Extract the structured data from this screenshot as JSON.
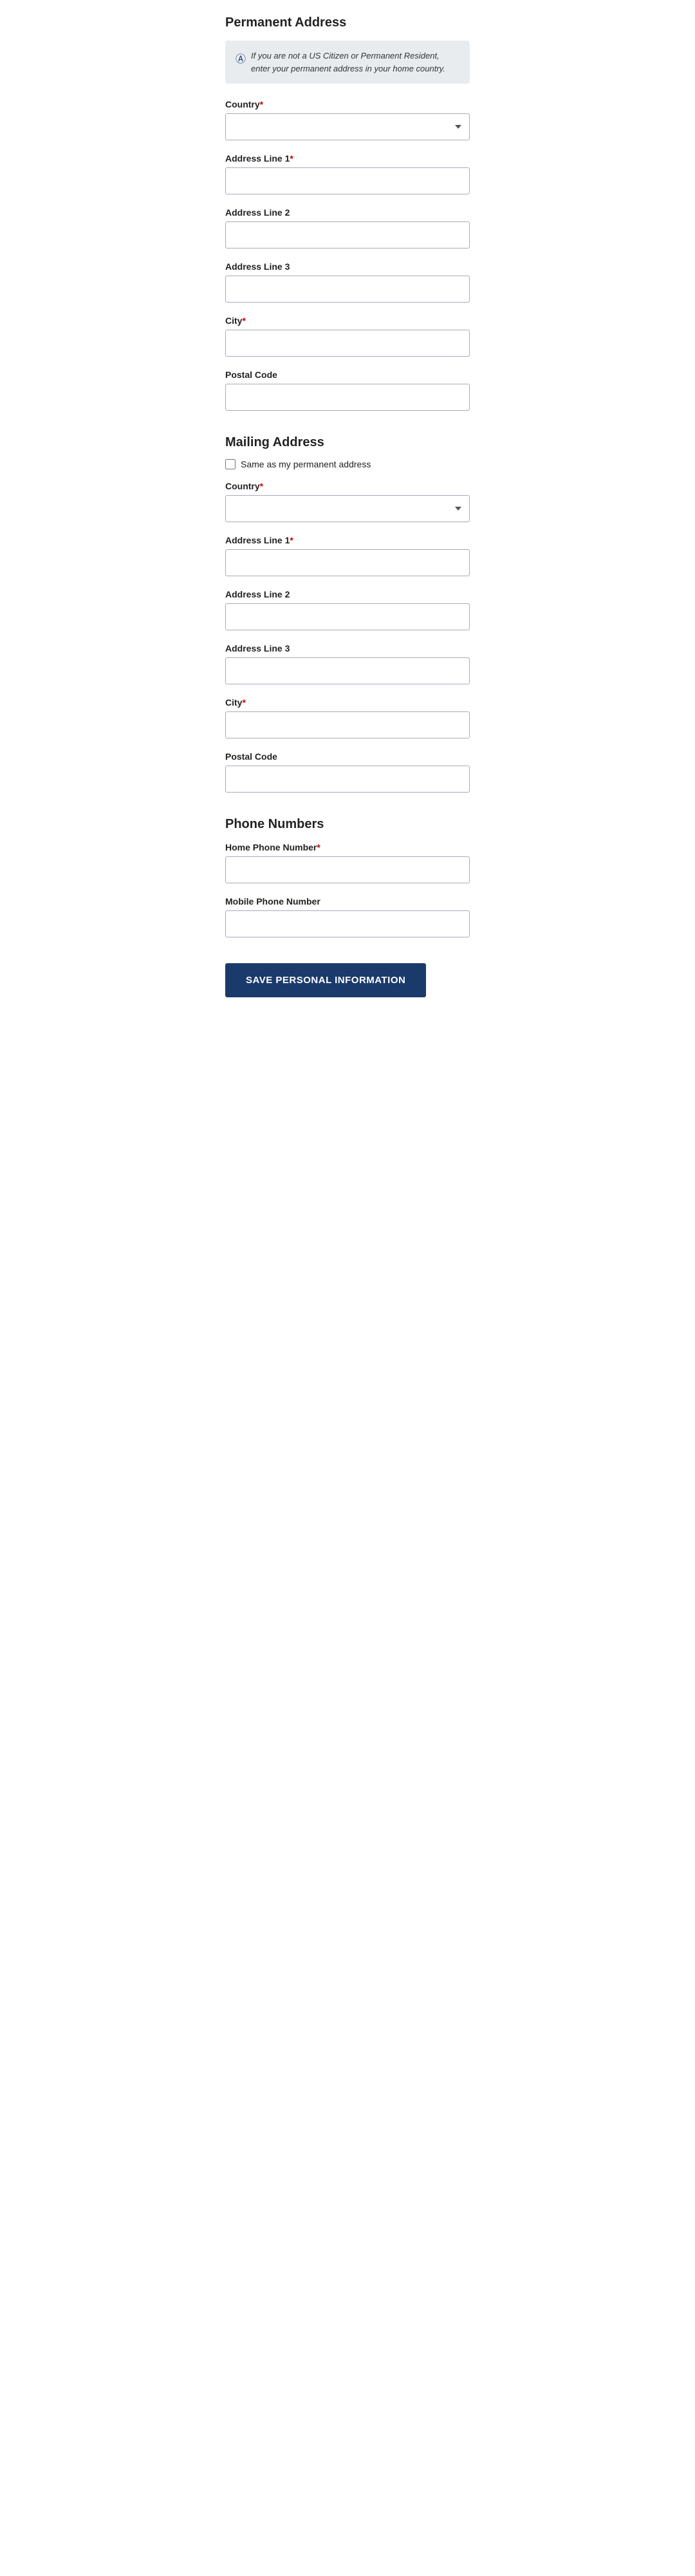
{
  "permanentAddress": {
    "sectionTitle": "Permanent Address",
    "infoText": "If you are not a US Citizen or Permanent Resident, enter your permanent address in your home country.",
    "countryLabel": "Country",
    "countryRequired": true,
    "addressLine1Label": "Address Line 1",
    "addressLine1Required": true,
    "addressLine2Label": "Address Line 2",
    "addressLine3Label": "Address Line 3",
    "cityLabel": "City",
    "cityRequired": true,
    "postalCodeLabel": "Postal Code"
  },
  "mailingAddress": {
    "sectionTitle": "Mailing Address",
    "sameAsLabel": "Same as my permanent address",
    "countryLabel": "Country",
    "countryRequired": true,
    "addressLine1Label": "Address Line 1",
    "addressLine1Required": true,
    "addressLine2Label": "Address Line 2",
    "addressLine3Label": "Address Line 3",
    "cityLabel": "City",
    "cityRequired": true,
    "postalCodeLabel": "Postal Code"
  },
  "phoneNumbers": {
    "sectionTitle": "Phone Numbers",
    "homePhoneLabel": "Home Phone Number",
    "homePhoneRequired": true,
    "mobilePhoneLabel": "Mobile Phone Number"
  },
  "saveButton": {
    "label": "SAVE PERSONAL INFORMATION"
  }
}
